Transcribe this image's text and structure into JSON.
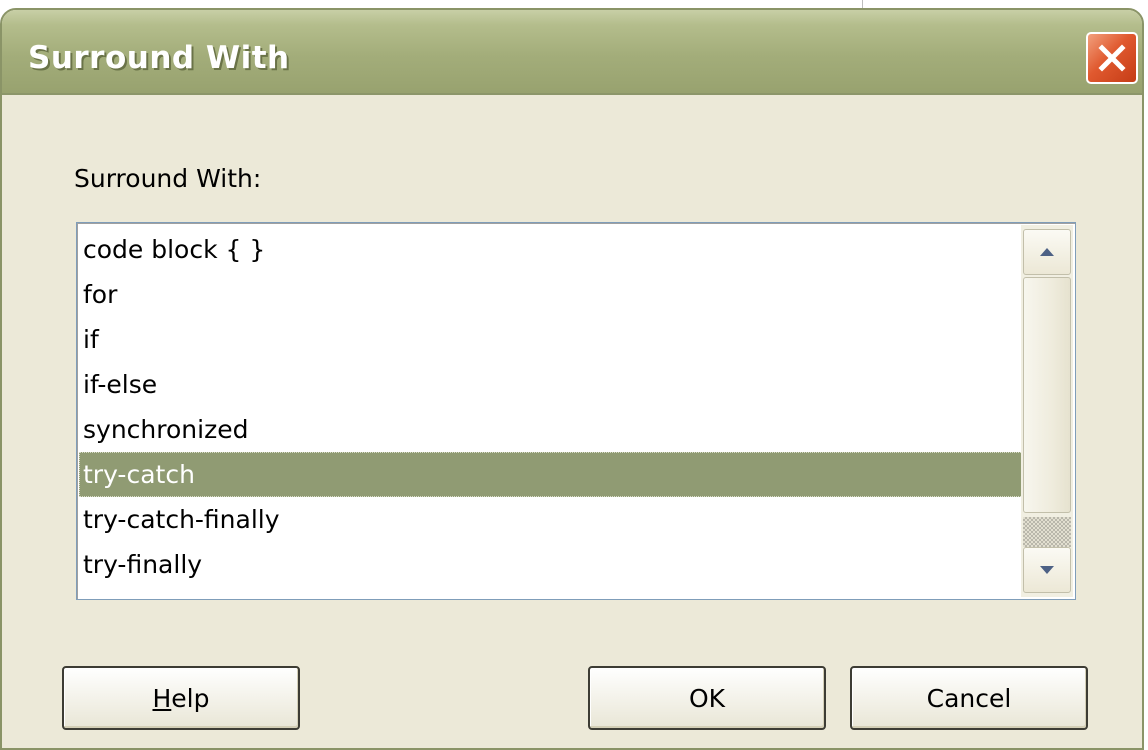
{
  "dialog": {
    "title": "Surround With",
    "close_icon": "close-icon",
    "label": "Surround With:",
    "selected_index": 5,
    "items": [
      {
        "label": "code block { }"
      },
      {
        "label": "for"
      },
      {
        "label": "if"
      },
      {
        "label": "if-else"
      },
      {
        "label": "synchronized"
      },
      {
        "label": "try-catch"
      },
      {
        "label": "try-catch-finally"
      },
      {
        "label": "try-finally"
      }
    ],
    "buttons": {
      "help_mnemonic": "H",
      "help_rest": "elp",
      "ok": "OK",
      "cancel": "Cancel"
    }
  },
  "background": {
    "fragments": [
      "c",
      "o"
    ]
  },
  "colors": {
    "titlebar": "#a3ad7a",
    "selection": "#909b73",
    "dialog_face": "#ece9d8",
    "close_button": "#e0592f"
  }
}
